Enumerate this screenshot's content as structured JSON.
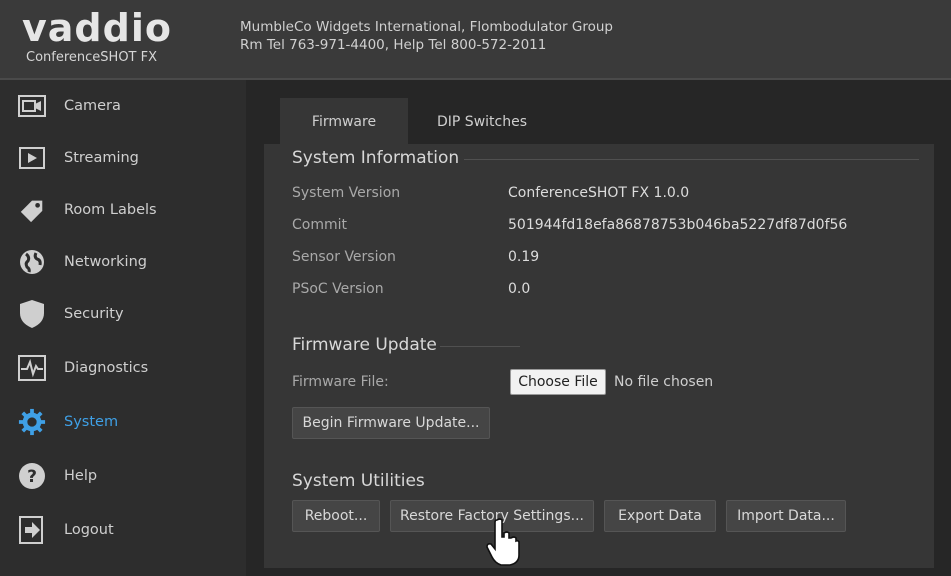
{
  "header": {
    "logo": "vaddio",
    "product": "ConferenceSHOT FX",
    "org_line": "MumbleCo Widgets International, Flombodulator Group",
    "contact_line": "Rm Tel 763-971-4400, Help Tel 800-572-2011"
  },
  "sidebar": {
    "items": [
      {
        "label": "Camera",
        "icon": "camera-icon"
      },
      {
        "label": "Streaming",
        "icon": "play-icon"
      },
      {
        "label": "Room Labels",
        "icon": "tag-icon"
      },
      {
        "label": "Networking",
        "icon": "globe-icon"
      },
      {
        "label": "Security",
        "icon": "shield-icon"
      },
      {
        "label": "Diagnostics",
        "icon": "pulse-icon"
      },
      {
        "label": "System",
        "icon": "gear-icon",
        "active": true
      },
      {
        "label": "Help",
        "icon": "help-icon"
      },
      {
        "label": "Logout",
        "icon": "logout-icon"
      }
    ],
    "active_color": "#3fa0e6"
  },
  "tabs": [
    {
      "label": "Firmware",
      "active": true
    },
    {
      "label": "DIP Switches",
      "active": false
    }
  ],
  "system_info": {
    "title": "System Information",
    "rows": [
      {
        "label": "System Version",
        "value": "ConferenceSHOT FX 1.0.0"
      },
      {
        "label": "Commit",
        "value": "501944fd18efa86878753b046ba5227df87d0f56"
      },
      {
        "label": "Sensor Version",
        "value": "0.19"
      },
      {
        "label": "PSoC Version",
        "value": "0.0"
      }
    ]
  },
  "firmware_update": {
    "title": "Firmware Update",
    "file_label": "Firmware File:",
    "choose_label": "Choose File",
    "no_file_text": "No file chosen",
    "begin_label": "Begin Firmware Update..."
  },
  "utilities": {
    "title": "System Utilities",
    "reboot_label": "Reboot...",
    "restore_label": "Restore Factory Settings...",
    "export_label": "Export Data",
    "import_label": "Import Data..."
  }
}
